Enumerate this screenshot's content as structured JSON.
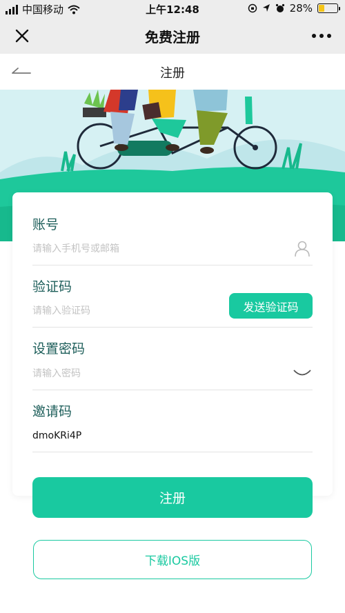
{
  "status_bar": {
    "carrier": "中国移动",
    "time": "上午12:48",
    "battery": "28%",
    "battery_level": 0.28
  },
  "navbar": {
    "title": "免费注册",
    "close_icon": "close-icon",
    "more_icon": "more-icon"
  },
  "page_header": {
    "title": "注册",
    "back_icon": "back-arrow-icon"
  },
  "form": {
    "account": {
      "label": "账号",
      "placeholder": "请输入手机号或邮箱",
      "icon": "user-icon"
    },
    "code": {
      "label": "验证码",
      "placeholder": "请输入验证码",
      "send_label": "发送验证码"
    },
    "password": {
      "label": "设置密码",
      "placeholder": "请输入密码",
      "icon": "eye-closed-icon"
    },
    "invite": {
      "label": "邀请码",
      "value": "dmoKRi4P"
    }
  },
  "actions": {
    "register_label": "注册",
    "download_label": "下载IOS版"
  },
  "colors": {
    "accent": "#19c9a0",
    "label": "#1d5e5a",
    "banner_sky": "#d6f1f3",
    "banner_ground": "#1ec89b"
  }
}
